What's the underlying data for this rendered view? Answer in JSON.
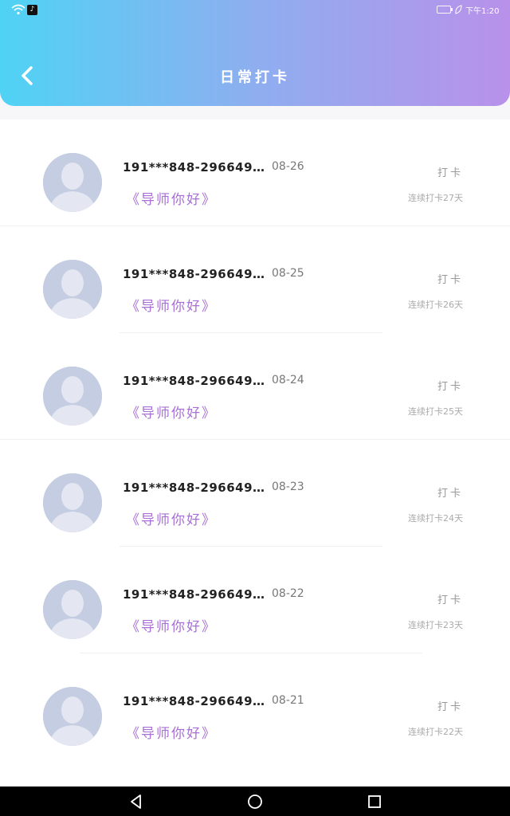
{
  "status_bar": {
    "time": "下午1:20",
    "icons": [
      "wifi-icon",
      "tiktok-icon",
      "battery-icon",
      "leaf-icon"
    ]
  },
  "header": {
    "title": "日常打卡",
    "back_icon": "chevron-left-icon"
  },
  "colors": {
    "header_gradient": [
      "#4fd3f5",
      "#8eaef0",
      "#b991ea"
    ],
    "book_title": "#a86fd6",
    "avatar_bg": "#c5cde2"
  },
  "entries": [
    {
      "phone": "191***848-296649…",
      "date": "08-26",
      "book": "《导师你好》",
      "action": "打卡",
      "streak": "连续打卡27天"
    },
    {
      "phone": "191***848-296649…",
      "date": "08-25",
      "book": "《导师你好》",
      "action": "打卡",
      "streak": "连续打卡26天"
    },
    {
      "phone": "191***848-296649…",
      "date": "08-24",
      "book": "《导师你好》",
      "action": "打卡",
      "streak": "连续打卡25天"
    },
    {
      "phone": "191***848-296649…",
      "date": "08-23",
      "book": "《导师你好》",
      "action": "打卡",
      "streak": "连续打卡24天"
    },
    {
      "phone": "191***848-296649…",
      "date": "08-22",
      "book": "《导师你好》",
      "action": "打卡",
      "streak": "连续打卡23天"
    },
    {
      "phone": "191***848-296649…",
      "date": "08-21",
      "book": "《导师你好》",
      "action": "打卡",
      "streak": "连续打卡22天"
    }
  ],
  "nav_bar": {
    "icons": [
      "nav-back-icon",
      "nav-home-icon",
      "nav-recent-icon"
    ]
  }
}
